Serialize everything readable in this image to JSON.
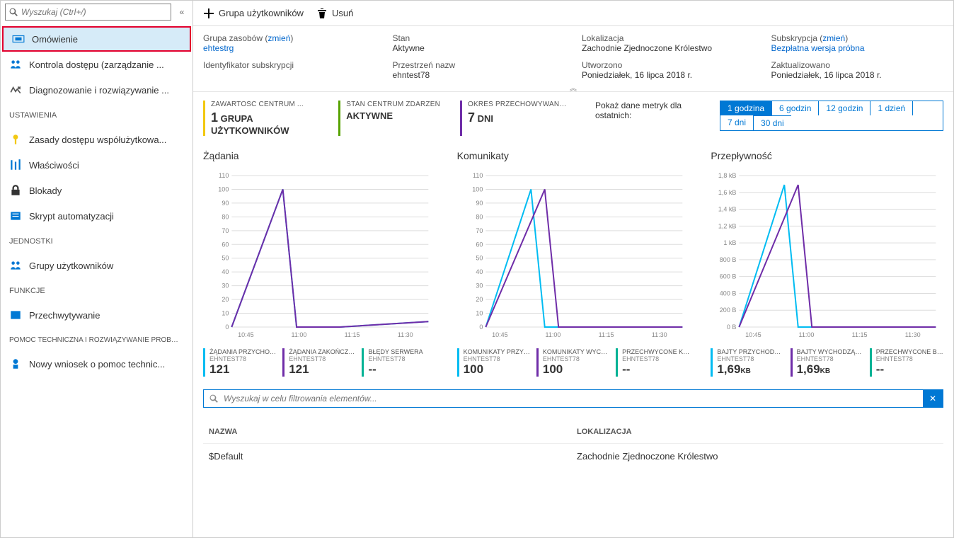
{
  "search": {
    "placeholder": "Wyszukaj (Ctrl+/)"
  },
  "nav": {
    "items": [
      {
        "label": "Omówienie"
      },
      {
        "label": "Kontrola dostępu (zarządzanie ..."
      },
      {
        "label": "Diagnozowanie i rozwiązywanie ..."
      }
    ],
    "ustawienia_header": "USTAWIENIA",
    "ustawienia": [
      {
        "label": "Zasady dostępu współużytkowa..."
      },
      {
        "label": "Właściwości"
      },
      {
        "label": "Blokady"
      },
      {
        "label": "Skrypt automatyzacji"
      }
    ],
    "jednostki_header": "JEDNOSTKI",
    "jednostki": [
      {
        "label": "Grupy użytkowników"
      }
    ],
    "funkcje_header": "FUNKCJE",
    "funkcje": [
      {
        "label": "Przechwytywanie"
      }
    ],
    "pomoc_header": "POMOC TECHNICZNA I ROZWIĄZYWANIE PROB…",
    "pomoc": [
      {
        "label": "Nowy wniosek o pomoc technic..."
      }
    ]
  },
  "toolbar": {
    "group": "Grupa użytkowników",
    "delete": "Usuń"
  },
  "details": {
    "resource_group_label": "Grupa zasobów",
    "change": "zmień",
    "resource_group_value": "ehtestrg",
    "sub_id_label": "Identyfikator subskrypcji",
    "state_label": "Stan",
    "state_value": "Aktywne",
    "namespace_label": "Przestrzeń nazw",
    "namespace_value": "ehntest78",
    "location_label": "Lokalizacja",
    "location_value": "Zachodnie Zjednoczone Królestwo",
    "created_label": "Utworzono",
    "created_value": "Poniedziałek, 16 lipca 2018 r.",
    "subscription_label": "Subskrypcja",
    "subscription_value": "Bezpłatna wersja próbna",
    "updated_label": "Zaktualizowano",
    "updated_value": "Poniedziałek, 16 lipca 2018 r."
  },
  "status_cards": [
    {
      "h": "ZAWARTOŚĆ CENTRUM ...",
      "v_big": "1",
      "v": "GRUPA UŻYTKOWNIKÓW",
      "color": "c-yellow"
    },
    {
      "h": "STAN CENTRUM ZDARZEŃ",
      "v": "AKTYWNE",
      "color": "c-green"
    },
    {
      "h": "OKRES PRZECHOWYWANIA KOMUNIKATÓW",
      "v_big": "7",
      "v": "DNI",
      "color": "c-purple"
    }
  ],
  "time": {
    "label": "Pokaż dane metryk dla ostatnich:",
    "pills": [
      "1 godzina",
      "6 godzin",
      "12 godzin",
      "1 dzień",
      "7 dni",
      "30 dni"
    ]
  },
  "charts": {
    "requests_title": "Żądania",
    "messages_title": "Komunikaty",
    "throughput_title": "Przepływność"
  },
  "metrics": {
    "sub": "EHNTEST78",
    "requests": [
      {
        "l": "ŻĄDANIA PRZYCHODZĄCE...",
        "v": "121",
        "c": "m-blue"
      },
      {
        "l": "ŻĄDANIA ZAKOŃCZONE ...",
        "v": "121",
        "c": "m-purple"
      },
      {
        "l": "BŁĘDY SERWERA",
        "v": "--",
        "c": "m-teal"
      }
    ],
    "messages": [
      {
        "l": "KOMUNIKATY PRZYCHO...",
        "v": "100",
        "c": "m-blue"
      },
      {
        "l": "KOMUNIKATY WYCHOD...",
        "v": "100",
        "c": "m-purple"
      },
      {
        "l": "PRZECHWYCONE KOM",
        "v": "--",
        "c": "m-teal"
      }
    ],
    "throughput": [
      {
        "l": "BAJTY PRZYCHODZĄCE (...",
        "v": "1,69",
        "u": "KB",
        "c": "m-blue"
      },
      {
        "l": "BAJTY WYCHODZĄCE (...",
        "v": "1,69",
        "u": "KB",
        "c": "m-purple"
      },
      {
        "l": "PRZECHWYCONE BAJTY",
        "v": "--",
        "c": "m-teal"
      }
    ]
  },
  "filter": {
    "placeholder": "Wyszukaj w celu filtrowania elementów..."
  },
  "table": {
    "col_name": "NAZWA",
    "col_loc": "LOKALIZACJA",
    "rows": [
      {
        "name": "$Default",
        "loc": "Zachodnie Zjednoczone Królestwo"
      }
    ]
  },
  "chart_data": [
    {
      "type": "line",
      "title": "Żądania",
      "xlabel": "",
      "ylabel": "",
      "x": [
        "10:45",
        "11:00",
        "11:15",
        "11:30"
      ],
      "yticks": [
        0,
        10,
        20,
        30,
        40,
        50,
        60,
        70,
        80,
        90,
        100,
        110
      ],
      "ylim": [
        0,
        110
      ],
      "series": [
        {
          "name": "Żądania przychodzące",
          "color": "#00bcf2",
          "values": [
            0,
            100,
            0,
            0,
            4
          ]
        },
        {
          "name": "Żądania zakończone",
          "color": "#6f2da8",
          "values": [
            0,
            100,
            0,
            0,
            4
          ]
        }
      ],
      "xpos": [
        0,
        0.26,
        0.33,
        0.55,
        1.0
      ]
    },
    {
      "type": "line",
      "title": "Komunikaty",
      "x": [
        "10:45",
        "11:00",
        "11:15",
        "11:30"
      ],
      "yticks": [
        0,
        10,
        20,
        30,
        40,
        50,
        60,
        70,
        80,
        90,
        100,
        110
      ],
      "ylim": [
        0,
        110
      ],
      "series": [
        {
          "name": "Komunikaty przychodzące",
          "color": "#00bcf2",
          "values": [
            0,
            100,
            0,
            0,
            0
          ],
          "xpos": [
            0,
            0.23,
            0.3,
            0.55,
            1.0
          ]
        },
        {
          "name": "Komunikaty wychodzące",
          "color": "#6f2da8",
          "values": [
            0,
            100,
            0,
            0,
            0
          ],
          "xpos": [
            0,
            0.3,
            0.37,
            0.55,
            1.0
          ]
        }
      ]
    },
    {
      "type": "line",
      "title": "Przepływność",
      "x": [
        "10:45",
        "11:00",
        "11:15",
        "11:30"
      ],
      "yticks_labels": [
        "0 B",
        "200 B",
        "400 B",
        "600 B",
        "800 B",
        "1 kB",
        "1,2 kB",
        "1,4 kB",
        "1,6 kB",
        "1,8 kB"
      ],
      "ylim": [
        0,
        1800
      ],
      "series": [
        {
          "name": "Bajty przychodzące",
          "color": "#00bcf2",
          "values": [
            0,
            1690,
            0,
            0,
            0
          ],
          "xpos": [
            0,
            0.23,
            0.3,
            0.55,
            1.0
          ]
        },
        {
          "name": "Bajty wychodzące",
          "color": "#6f2da8",
          "values": [
            0,
            1690,
            0,
            0,
            0
          ],
          "xpos": [
            0,
            0.3,
            0.37,
            0.55,
            1.0
          ]
        }
      ]
    }
  ]
}
